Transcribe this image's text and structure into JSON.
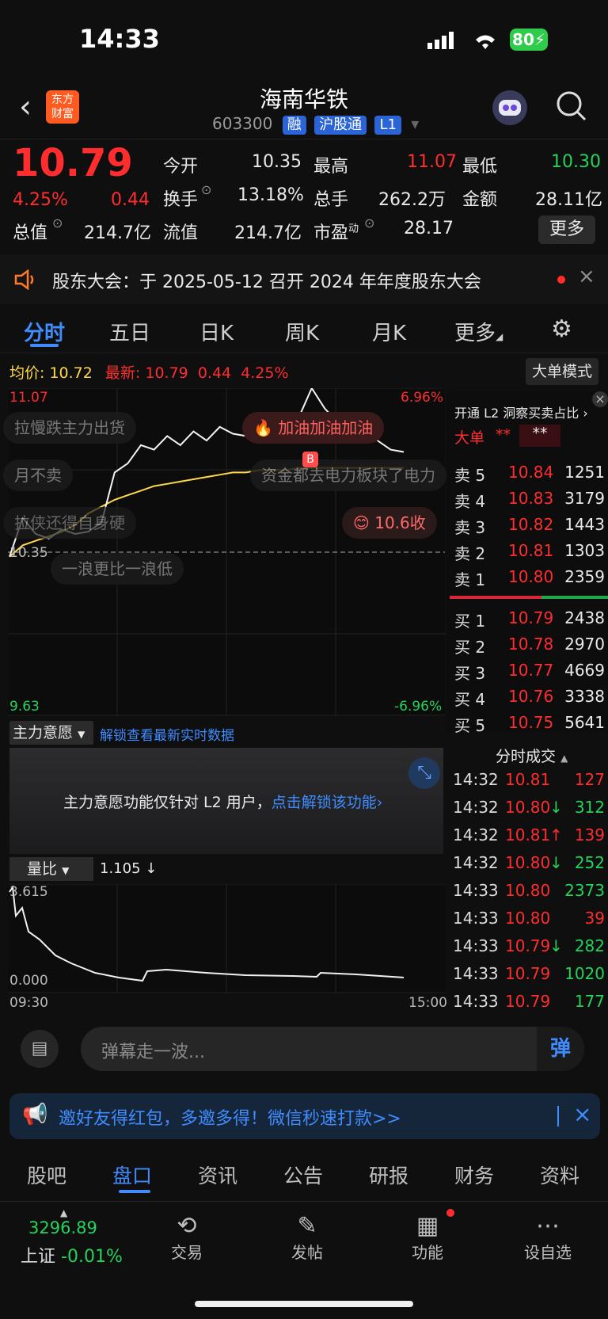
{
  "status_bar": {
    "time": "14:33",
    "battery": "80"
  },
  "header": {
    "title": "海南华铁",
    "code": "603300",
    "tags": [
      "融",
      "沪股通",
      "L1"
    ],
    "logo_line1": "东方",
    "logo_line2": "财富"
  },
  "quote": {
    "price": "10.79",
    "pct": "4.25%",
    "change": "0.44",
    "labels": {
      "open": "今开",
      "high": "最高",
      "low": "最低",
      "turnover": "换手",
      "volume": "总手",
      "amount": "金额",
      "total_value": "总值",
      "float_value": "流值",
      "pe": "市盈",
      "pe_sup": "动"
    },
    "open": "10.35",
    "high": "11.07",
    "low": "10.30",
    "turnover": "13.18%",
    "volume": "262.2万",
    "amount": "28.11亿",
    "total_value": "214.7亿",
    "float_value": "214.7亿",
    "pe": "28.17",
    "more": "更多"
  },
  "notice": {
    "text": "股东大会：于 2025-05-12 召开 2024 年年度股东大会"
  },
  "chart_tabs": [
    "分时",
    "五日",
    "日K",
    "周K",
    "月K",
    "更多"
  ],
  "chart_header": {
    "avg_label": "均价:",
    "avg": "10.72",
    "latest_label": "最新:",
    "latest": "10.79",
    "change": "0.44",
    "pct": "4.25%",
    "big_order": "大单模式"
  },
  "price_axis": {
    "top": "11.07",
    "bottom": "9.63",
    "mid": "10.35",
    "top_pct": "6.96%",
    "bottom_pct": "-6.96%"
  },
  "danmaku": [
    "拉慢跌主力出货",
    "月不卖",
    "拉侠还得自身硬",
    "一浪更比一浪低",
    "加油加油加油",
    "资金都去电力板块了电力",
    "10.6收"
  ],
  "chart_data": {
    "type": "line",
    "x": [
      "09:30",
      "15:00"
    ],
    "ylim": [
      9.63,
      11.07
    ],
    "series": [
      {
        "values": [
          10.33,
          10.5,
          10.43,
          10.41,
          10.45,
          10.43,
          10.44,
          10.48,
          10.7,
          10.74,
          10.82,
          10.8,
          10.86,
          10.82,
          10.88,
          10.84,
          10.9,
          10.87,
          10.86,
          10.96,
          10.92,
          10.9,
          10.94,
          11.07,
          10.98,
          10.92,
          10.88,
          10.86,
          10.84,
          10.8,
          10.79
        ]
      },
      {
        "values": [
          10.33,
          10.38,
          10.4,
          10.42,
          10.44,
          10.47,
          10.52,
          10.55,
          10.58,
          10.6,
          10.62,
          10.64,
          10.65,
          10.66,
          10.67,
          10.68,
          10.69,
          10.7,
          10.7,
          10.71,
          10.71,
          10.71,
          10.72,
          10.72,
          10.72,
          10.72,
          10.72,
          10.72,
          10.72,
          10.72,
          10.72
        ]
      }
    ]
  },
  "orderbook": {
    "header": "开通 L2 洞察买卖占比",
    "big_label": "大单",
    "big_val1": "**",
    "big_val2": "**",
    "asks": [
      {
        "label": "卖 5",
        "price": "10.84",
        "qty": "1251"
      },
      {
        "label": "卖 4",
        "price": "10.83",
        "qty": "3179"
      },
      {
        "label": "卖 3",
        "price": "10.82",
        "qty": "1443"
      },
      {
        "label": "卖 2",
        "price": "10.81",
        "qty": "1303"
      },
      {
        "label": "卖 1",
        "price": "10.80",
        "qty": "2359"
      }
    ],
    "bids": [
      {
        "label": "买 1",
        "price": "10.79",
        "qty": "2438"
      },
      {
        "label": "买 2",
        "price": "10.78",
        "qty": "2970"
      },
      {
        "label": "买 3",
        "price": "10.77",
        "qty": "4669"
      },
      {
        "label": "买 4",
        "price": "10.76",
        "qty": "3338"
      },
      {
        "label": "买 5",
        "price": "10.75",
        "qty": "5641"
      }
    ]
  },
  "trades_title": "分时成交",
  "trades": [
    {
      "time": "14:32",
      "price": "10.81",
      "arrow": "",
      "qty": "127",
      "qcolor": "red"
    },
    {
      "time": "14:32",
      "price": "10.80",
      "arrow": "↓",
      "qty": "312",
      "qcolor": "green"
    },
    {
      "time": "14:32",
      "price": "10.81",
      "arrow": "↑",
      "qty": "139",
      "qcolor": "red"
    },
    {
      "time": "14:32",
      "price": "10.80",
      "arrow": "↓",
      "qty": "252",
      "qcolor": "green"
    },
    {
      "time": "14:33",
      "price": "10.80",
      "arrow": "",
      "qty": "2373",
      "qcolor": "green"
    },
    {
      "time": "14:33",
      "price": "10.80",
      "arrow": "",
      "qty": "39",
      "qcolor": "red"
    },
    {
      "time": "14:33",
      "price": "10.79",
      "arrow": "↓",
      "qty": "282",
      "qcolor": "green"
    },
    {
      "time": "14:33",
      "price": "10.79",
      "arrow": "",
      "qty": "1020",
      "qcolor": "green"
    },
    {
      "time": "14:33",
      "price": "10.79",
      "arrow": "",
      "qty": "177",
      "qcolor": "green"
    }
  ],
  "main_force": {
    "dropdown": "主力意愿",
    "link": "解锁查看最新实时数据",
    "msg": "主力意愿功能仅针对 L2 用户，",
    "msg_link": "点击解锁该功能"
  },
  "volume_ratio": {
    "dropdown": "量比",
    "value": "1.105 ↓",
    "top": "3.615",
    "bottom": "0.000",
    "start": "09:30",
    "end": "15:00"
  },
  "comment": {
    "placeholder": "弹幕走一波...",
    "danmaku_btn": "弹"
  },
  "invite": {
    "text": "邀好友得红包，多邀多得！微信秒速打款>>"
  },
  "bottom_tabs": [
    "股吧",
    "盘口",
    "资讯",
    "公告",
    "研报",
    "财务",
    "资料"
  ],
  "dock": {
    "index_value": "3296.89",
    "index_name": "上证",
    "index_pct": "-0.01%",
    "trade": "交易",
    "post": "发帖",
    "func": "功能",
    "watch": "设自选"
  },
  "colors": {
    "up": "#ff2d2d",
    "down": "#23d35a",
    "accent": "#3f8cff",
    "avg": "#ffd84a"
  }
}
